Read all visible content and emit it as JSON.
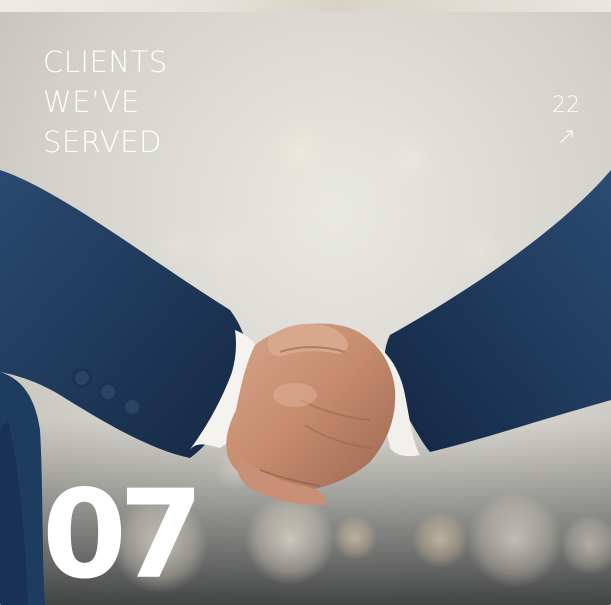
{
  "card": {
    "headline_lines": [
      "CLIENTS",
      "WE’VE",
      "SERVED"
    ],
    "count": "22",
    "count_arrow": "↗",
    "index": "07",
    "image_description": "handshake-photo"
  },
  "colors": {
    "text": "#ffffff",
    "sleeve": "#1f3a5c",
    "background": "#d9d6cf"
  }
}
